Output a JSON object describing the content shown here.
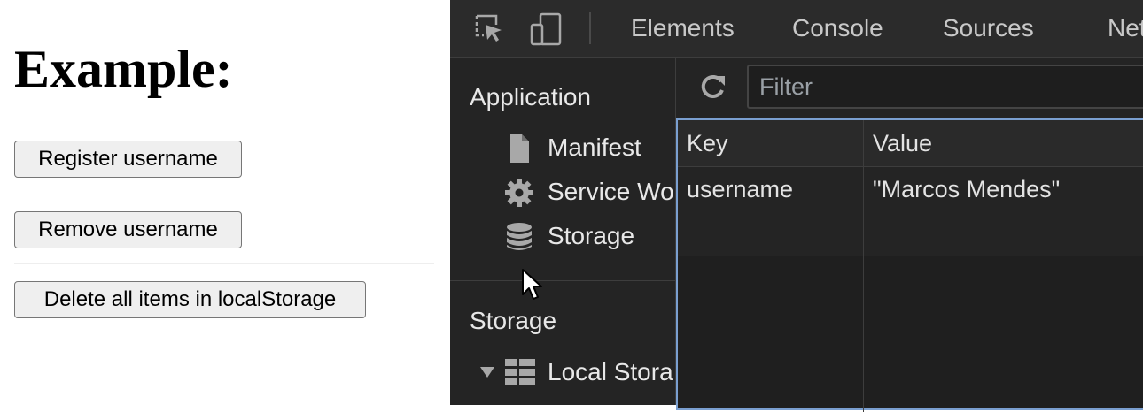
{
  "page": {
    "heading": "Example:",
    "buttons": {
      "register": "Register username",
      "remove": "Remove username",
      "delete_all": "Delete all items in localStorage"
    }
  },
  "devtools": {
    "tabs": [
      "Elements",
      "Console",
      "Sources",
      "Netw"
    ],
    "sidebar": {
      "application_title": "Application",
      "application_items": [
        {
          "label": "Manifest",
          "icon": "document-icon"
        },
        {
          "label": "Service Wo",
          "icon": "gear-icon"
        },
        {
          "label": "Storage",
          "icon": "database-icon"
        }
      ],
      "storage_title": "Storage",
      "local_storage_label": "Local Stora"
    },
    "filter": {
      "placeholder": "Filter",
      "value": ""
    },
    "table": {
      "columns": [
        "Key",
        "Value"
      ],
      "rows": [
        {
          "key": "username",
          "value": "\"Marcos Mendes\""
        }
      ]
    },
    "colors": {
      "accent_border": "#7a9fd0",
      "background": "#242424"
    }
  }
}
